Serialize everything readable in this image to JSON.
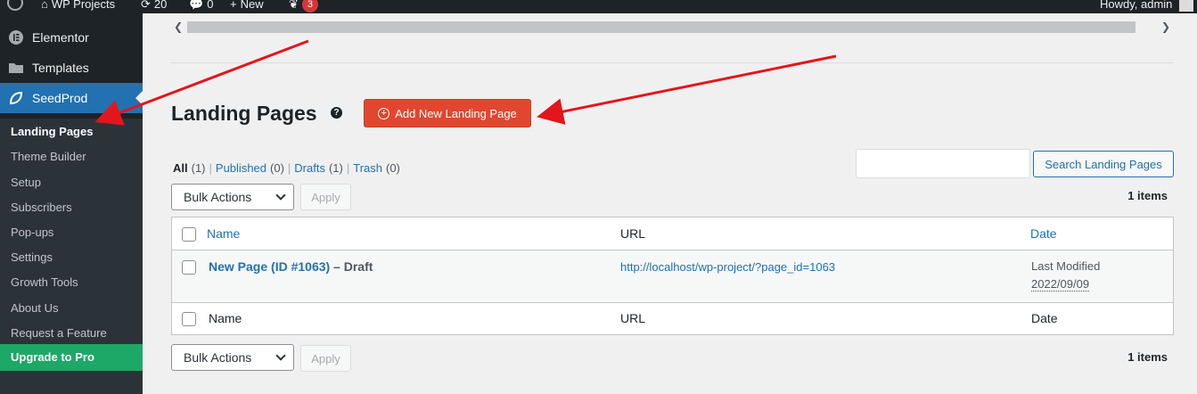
{
  "adminbar": {
    "site_name": "WP Projects",
    "updates_count": "20",
    "comments_count": "0",
    "new_label": "New",
    "notif_count": "3",
    "howdy": "Howdy, admin"
  },
  "sidebar": {
    "items": [
      {
        "label": "Elementor"
      },
      {
        "label": "Templates"
      },
      {
        "label": "SeedProd"
      }
    ],
    "submenu": [
      {
        "label": "Landing Pages"
      },
      {
        "label": "Theme Builder"
      },
      {
        "label": "Setup"
      },
      {
        "label": "Subscribers"
      },
      {
        "label": "Pop-ups"
      },
      {
        "label": "Settings"
      },
      {
        "label": "Growth Tools"
      },
      {
        "label": "About Us"
      },
      {
        "label": "Request a Feature"
      }
    ],
    "upgrade_label": "Upgrade to Pro"
  },
  "main": {
    "title": "Landing Pages",
    "add_button": "Add New Landing Page",
    "filters": {
      "all": "All",
      "all_count": "(1)",
      "published": "Published",
      "published_count": "(0)",
      "drafts": "Drafts",
      "drafts_count": "(1)",
      "trash": "Trash",
      "trash_count": "(0)"
    },
    "search_button": "Search Landing Pages",
    "bulk_actions": "Bulk Actions",
    "apply": "Apply",
    "items_count": "1 items",
    "table": {
      "col_name": "Name",
      "col_url": "URL",
      "col_date": "Date",
      "rows": [
        {
          "title": "New Page (ID #1063)",
          "state": " – Draft",
          "url": "http://localhost/wp-project/?page_id=1063",
          "date_label": "Last Modified",
          "date": "2022/09/09"
        }
      ]
    }
  },
  "colors": {
    "accent": "#2271b1",
    "add_button": "#e0472e",
    "upgrade": "#1da867",
    "annotation_arrow": "#e3161b"
  }
}
